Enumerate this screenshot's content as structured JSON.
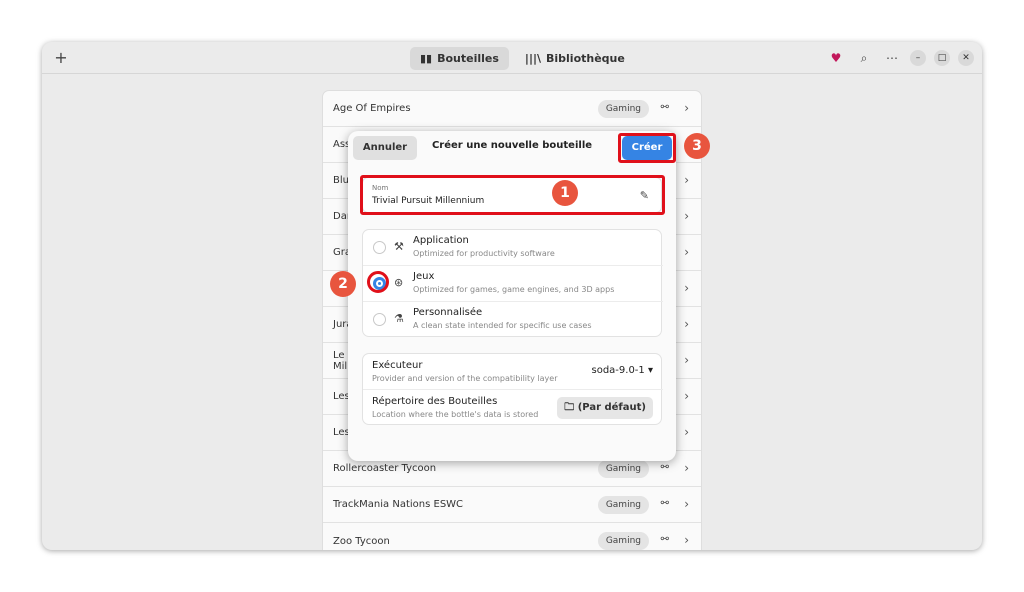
{
  "headerbar": {
    "add_icon": "plus-icon",
    "tabs": [
      {
        "label": "Bouteilles",
        "icon": "bottles-icon",
        "active": true
      },
      {
        "label": "Bibliothèque",
        "icon": "library-icon",
        "active": false
      }
    ],
    "right_icons": [
      "heart-icon",
      "search-icon",
      "more-icon",
      "minimize-icon",
      "maximize-icon",
      "close-icon"
    ]
  },
  "bottles": [
    {
      "name": "Age Of Empires",
      "tag": "Gaming"
    },
    {
      "name": "Ass",
      "tag": ""
    },
    {
      "name": "Blu",
      "tag": ""
    },
    {
      "name": "Dar",
      "tag": ""
    },
    {
      "name": "Gra",
      "tag": ""
    },
    {
      "name": "",
      "tag": ""
    },
    {
      "name": "Jura",
      "tag": ""
    },
    {
      "name": "Le S\nMilli",
      "tag": ""
    },
    {
      "name": "Les",
      "tag": ""
    },
    {
      "name": "Les",
      "tag": ""
    },
    {
      "name": "Rollercoaster Tycoon",
      "tag": "Gaming"
    },
    {
      "name": "TrackMania Nations ESWC",
      "tag": "Gaming"
    },
    {
      "name": "Zoo Tycoon",
      "tag": "Gaming"
    }
  ],
  "dialog": {
    "cancel_label": "Annuler",
    "title": "Créer une nouvelle bouteille",
    "create_label": "Créer",
    "name_field": {
      "label": "Nom",
      "value": "Trivial Pursuit Millennium"
    },
    "environments": [
      {
        "title": "Application",
        "subtitle": "Optimized for productivity software",
        "checked": false
      },
      {
        "title": "Jeux",
        "subtitle": "Optimized for games, game engines, and 3D apps",
        "checked": true
      },
      {
        "title": "Personnalisée",
        "subtitle": "A clean state intended for specific use cases",
        "checked": false
      }
    ],
    "runner": {
      "title": "Exécuteur",
      "subtitle": "Provider and version of the compatibility layer",
      "value": "soda-9.0-1"
    },
    "directory": {
      "title": "Répertoire des Bouteilles",
      "subtitle": "Location where the bottle's data is stored",
      "button_label": "(Par défaut)"
    }
  },
  "annotations": {
    "step1": "1",
    "step2": "2",
    "step3": "3"
  },
  "colors": {
    "accent": "#3584e4",
    "highlight": "#e0101a",
    "badge": "#e8553e",
    "heart": "#c2185b"
  }
}
